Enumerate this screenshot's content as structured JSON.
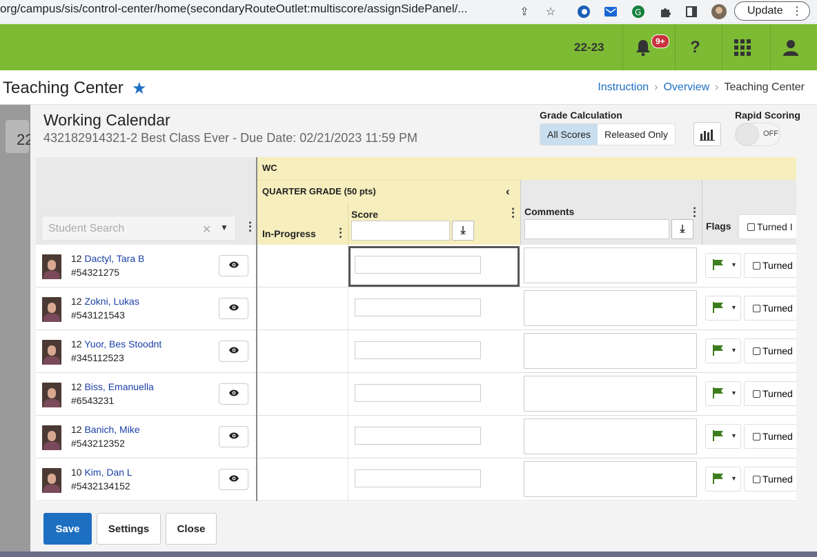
{
  "browser": {
    "url": "org/campus/sis/control-center/home(secondaryRouteOutlet:multiscore/assignSidePanel/...",
    "update_label": "Update"
  },
  "topbar": {
    "year": "22-23",
    "notif_badge": "9+",
    "help_label": "?"
  },
  "page": {
    "title": "Teaching Center",
    "breadcrumbs": [
      "Instruction",
      "Overview",
      "Teaching Center"
    ]
  },
  "background": {
    "card_number": "22"
  },
  "panel": {
    "title": "Working Calendar",
    "subtitle": "432182914321-2 Best Class Ever - Due Date: 02/21/2023 11:59 PM",
    "grade_calc_label": "Grade Calculation",
    "grade_calc_options": [
      "All Scores",
      "Released Only"
    ],
    "grade_calc_selected": "All Scores",
    "rapid_scoring_label": "Rapid Scoring",
    "rapid_scoring_state": "OFF"
  },
  "grid": {
    "search_placeholder": "Student Search",
    "group_header": "WC",
    "assignment_header": "QUARTER GRADE (50 pts)",
    "col_in_progress": "In-Progress",
    "col_score": "Score",
    "col_comments": "Comments",
    "col_flags": "Flags",
    "turned_in_label": "Turned In",
    "header_turned_in": "Turned I"
  },
  "students": [
    {
      "grade": "12",
      "name": "Dactyl, Tara B",
      "id": "#54321275"
    },
    {
      "grade": "12",
      "name": "Zokni, Lukas",
      "id": "#543121543"
    },
    {
      "grade": "12",
      "name": "Yuor, Bes Stoodnt",
      "id": "#345112523"
    },
    {
      "grade": "12",
      "name": "Biss, Emanuella",
      "id": "#6543231"
    },
    {
      "grade": "12",
      "name": "Banich, Mike",
      "id": "#543212352"
    },
    {
      "grade": "10",
      "name": "Kim, Dan L",
      "id": "#5432134152"
    }
  ],
  "footer": {
    "save": "Save",
    "settings": "Settings",
    "close": "Close"
  },
  "colors": {
    "brand_green": "#7dbb34",
    "primary_blue": "#1d6fc2",
    "assignment_yellow": "#f6eebd",
    "flag_green": "#3e7d1e"
  }
}
